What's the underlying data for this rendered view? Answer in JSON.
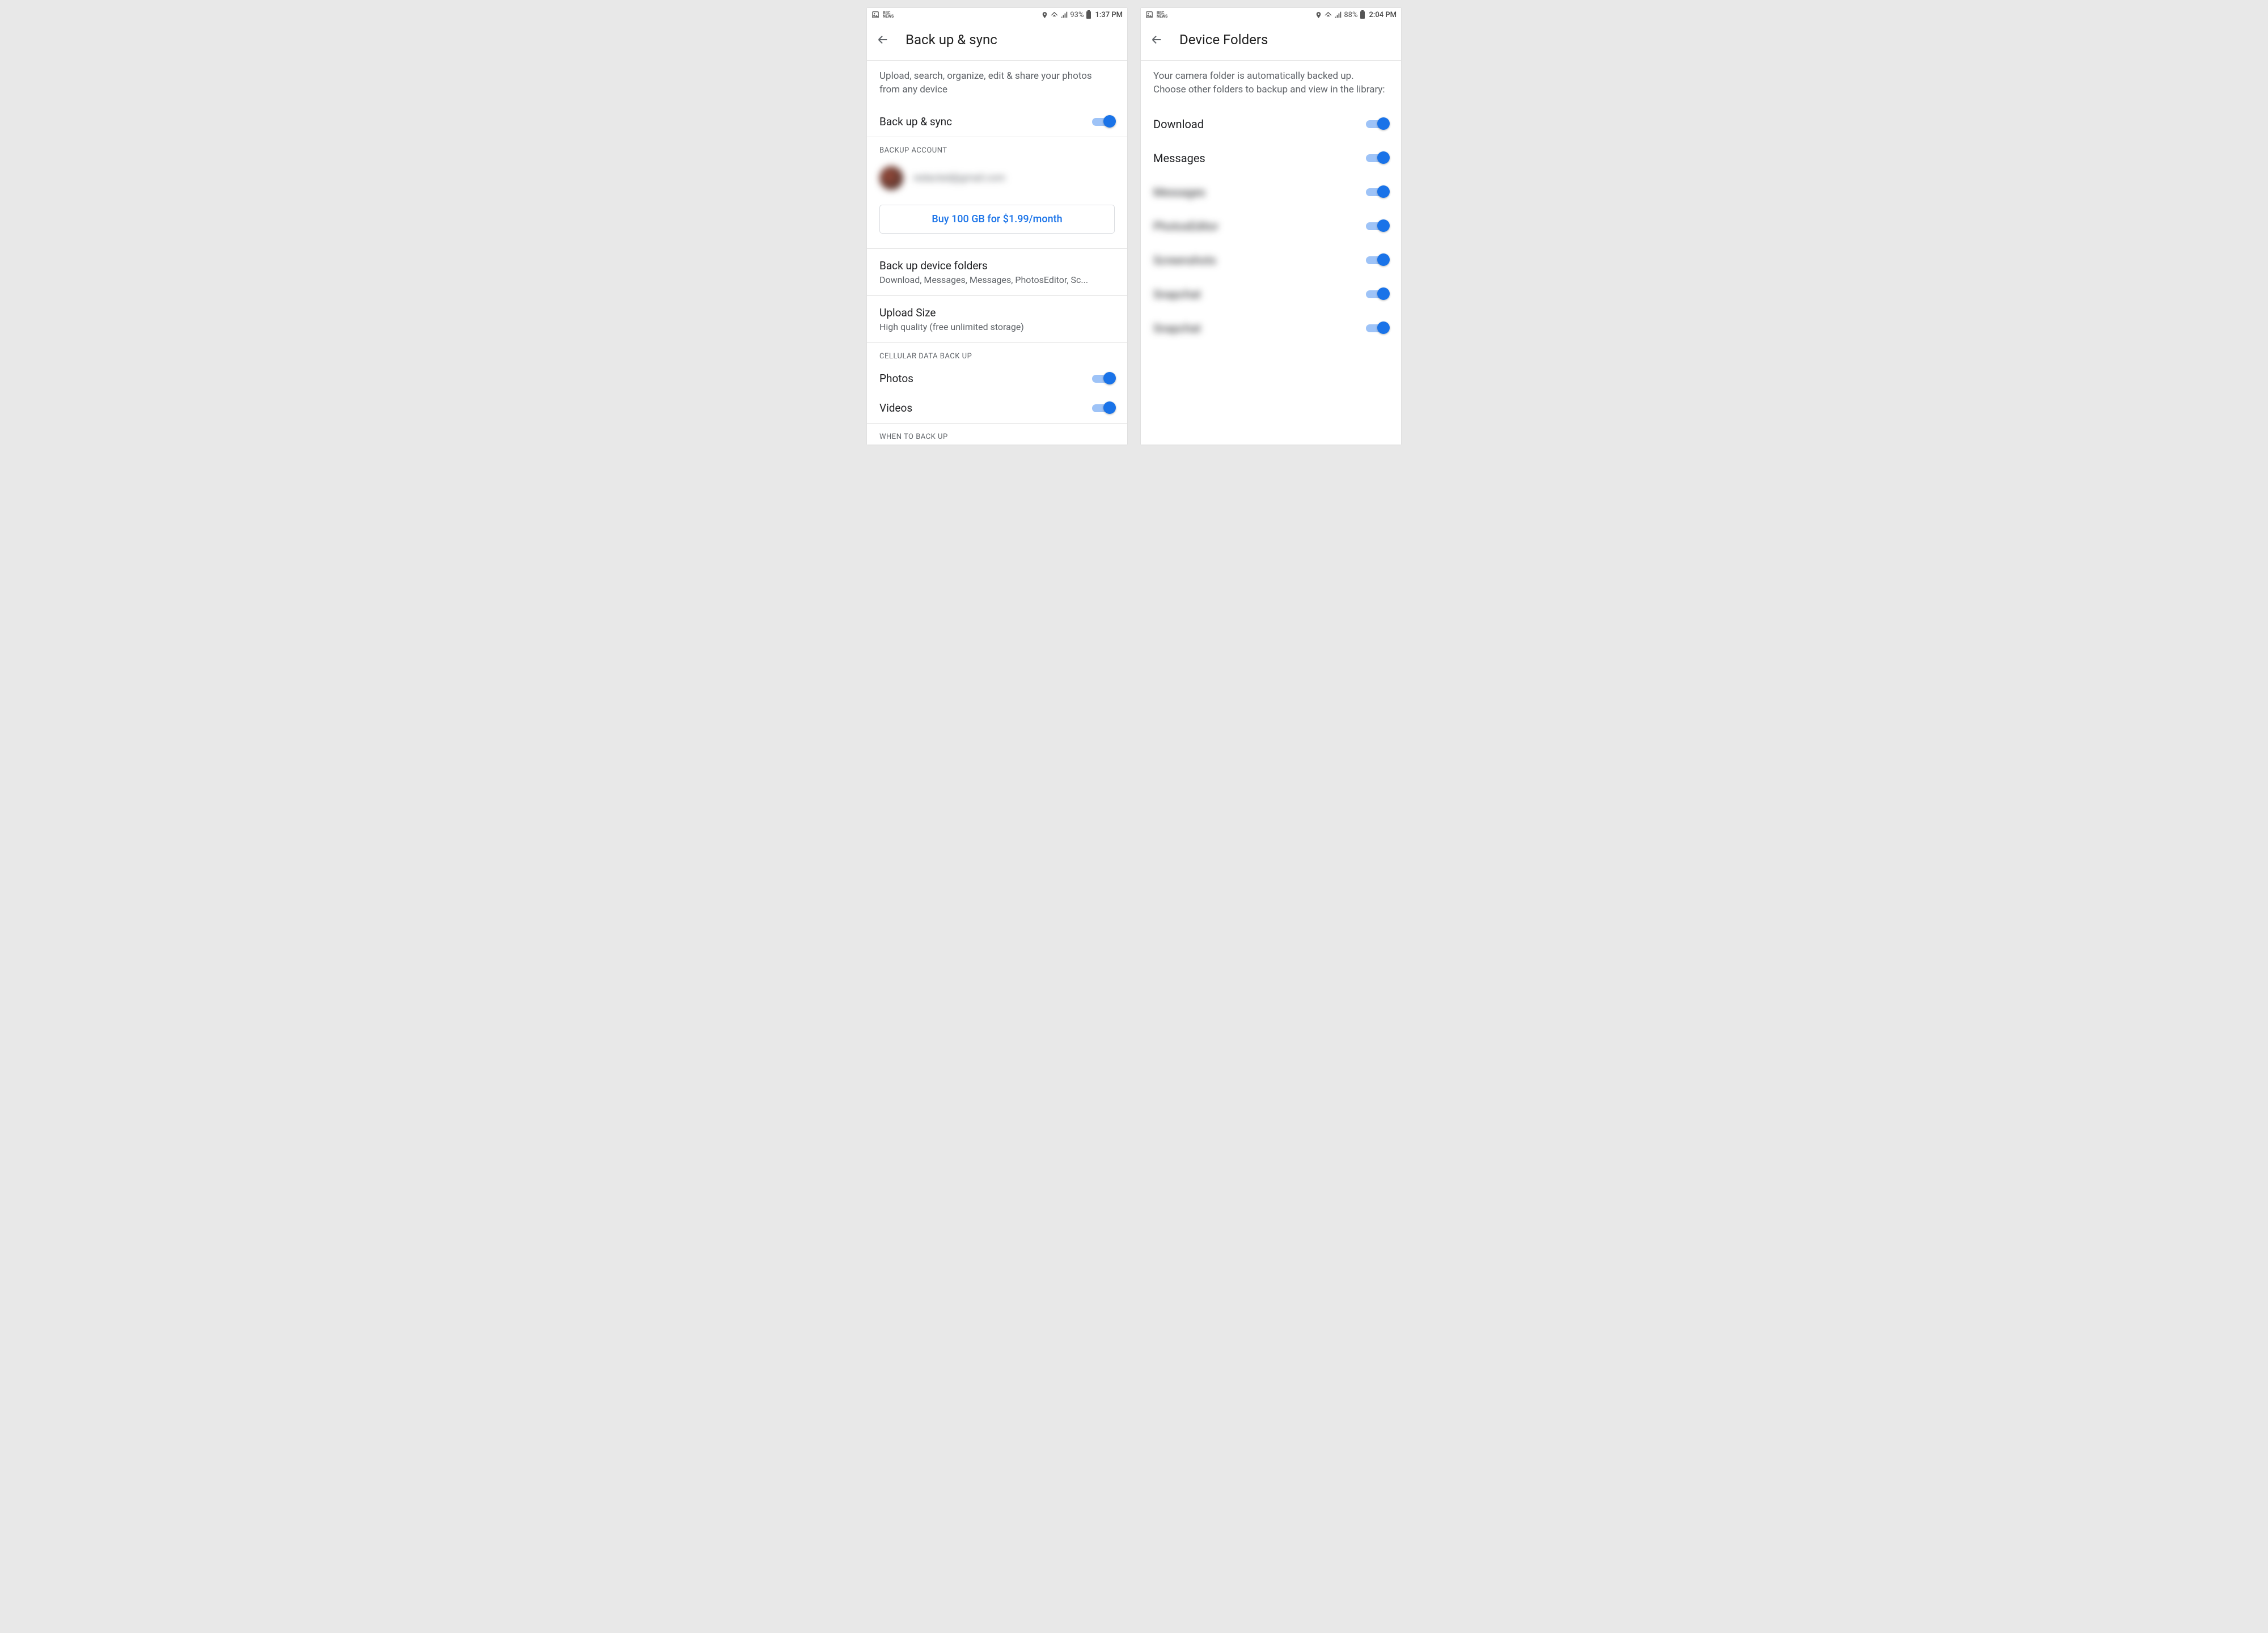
{
  "left": {
    "statusbar": {
      "battery": "93%",
      "time": "1:37 PM"
    },
    "title": "Back up & sync",
    "intro": "Upload, search, organize, edit & share your photos from any device",
    "main_toggle": {
      "label": "Back up & sync",
      "on": true
    },
    "backup_account_header": "BACKUP ACCOUNT",
    "account_email": "redacted@gmail.com",
    "buy_button": "Buy 100 GB for $1.99/month",
    "device_folders": {
      "title": "Back up device folders",
      "subtitle": "Download, Messages, Messages, PhotosEditor, Sc..."
    },
    "upload_size": {
      "title": "Upload Size",
      "subtitle": "High quality (free unlimited storage)"
    },
    "cellular_header": "CELLULAR DATA BACK UP",
    "cellular": [
      {
        "label": "Photos",
        "on": true
      },
      {
        "label": "Videos",
        "on": true
      }
    ],
    "when_header": "WHEN TO BACK UP"
  },
  "right": {
    "statusbar": {
      "battery": "88%",
      "time": "2:04 PM"
    },
    "title": "Device Folders",
    "intro": "Your camera folder is automatically backed up. Choose other folders to backup and view in the library:",
    "folders": [
      {
        "label": "Download",
        "on": true,
        "blurred": false
      },
      {
        "label": "Messages",
        "on": true,
        "blurred": false
      },
      {
        "label": "Messages",
        "on": true,
        "blurred": true
      },
      {
        "label": "PhotosEditor",
        "on": true,
        "blurred": true
      },
      {
        "label": "Screenshots",
        "on": true,
        "blurred": true
      },
      {
        "label": "Snapchat",
        "on": true,
        "blurred": true
      },
      {
        "label": "Snapchat",
        "on": true,
        "blurred": true
      }
    ]
  }
}
